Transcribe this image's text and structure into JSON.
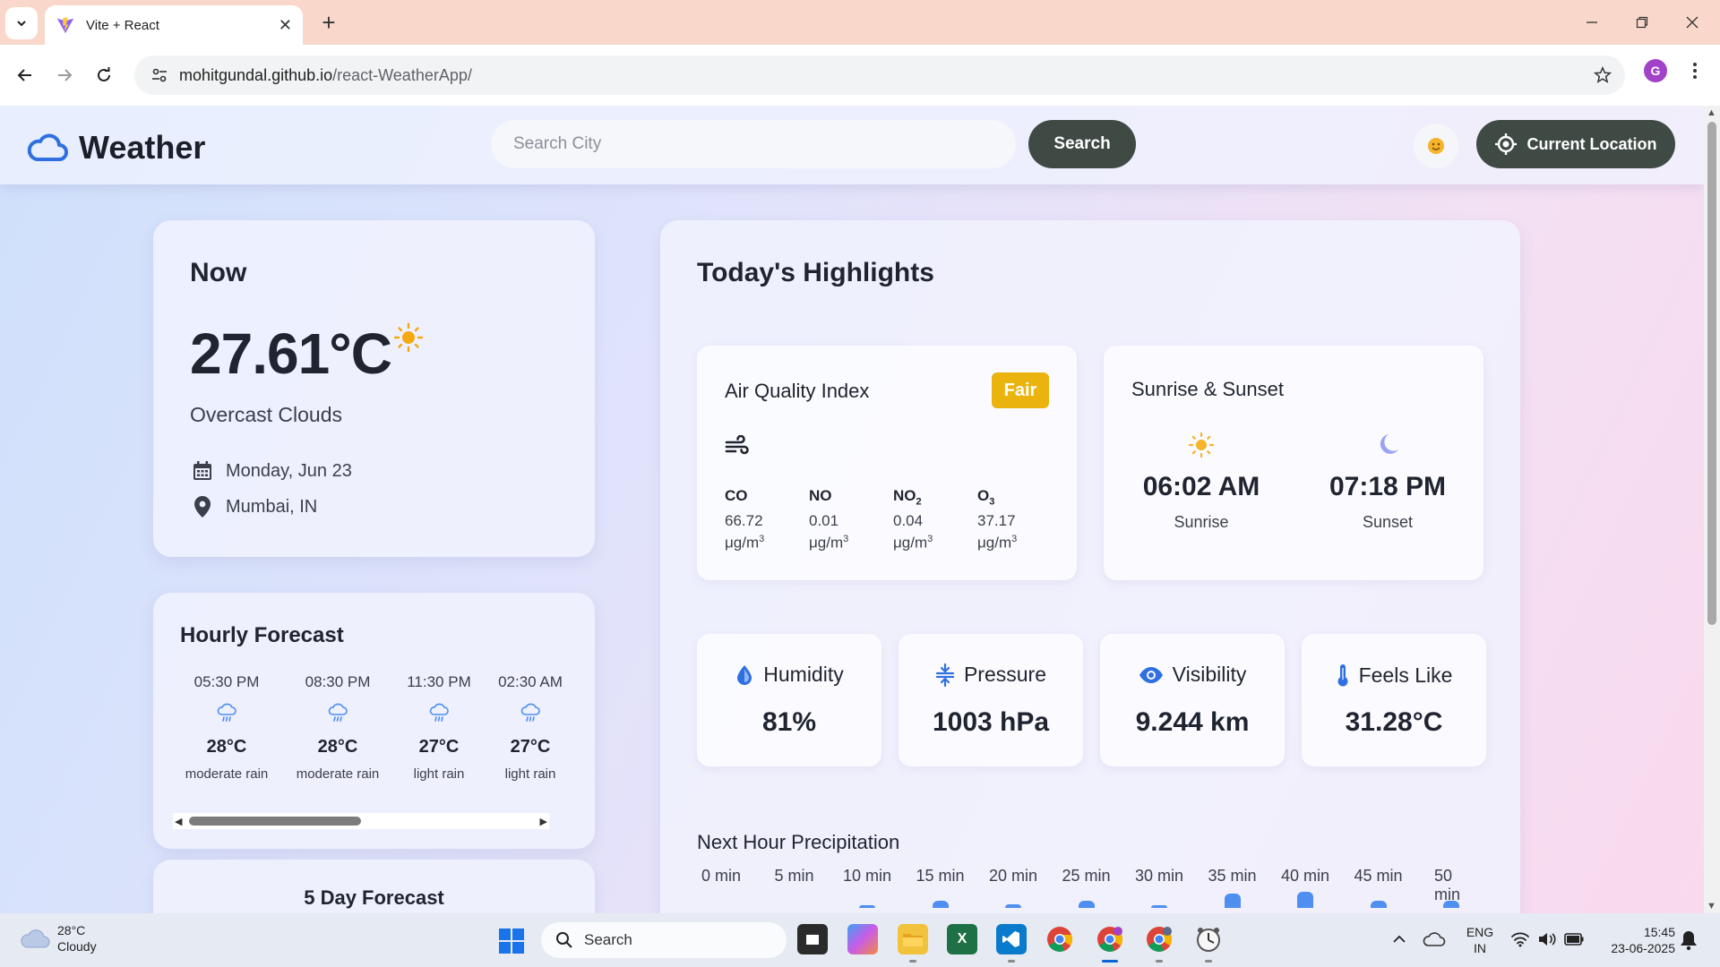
{
  "browser": {
    "tab_title": "Vite + React",
    "url_host": "mohitgundal.github.io",
    "url_path": "/react-WeatherApp/",
    "profile_initial": "G"
  },
  "header": {
    "brand": "Weather",
    "search_placeholder": "Search City",
    "search_button": "Search",
    "location_button": "Current Location"
  },
  "now": {
    "label": "Now",
    "temperature": "27.61°C",
    "description": "Overcast Clouds",
    "date": "Monday, Jun 23",
    "location": "Mumbai, IN"
  },
  "hourly": {
    "title": "Hourly Forecast",
    "items": [
      {
        "time": "05:30 PM",
        "temp": "28°C",
        "desc": "moderate rain",
        "icon": "rain-icon"
      },
      {
        "time": "08:30 PM",
        "temp": "28°C",
        "desc": "moderate rain",
        "icon": "rain-icon"
      },
      {
        "time": "11:30 PM",
        "temp": "27°C",
        "desc": "light rain",
        "icon": "rain-icon"
      },
      {
        "time": "02:30 AM",
        "temp": "27°C",
        "desc": "light rain",
        "icon": "rain-icon"
      }
    ]
  },
  "five_day": {
    "title": "5 Day Forecast"
  },
  "highlights": {
    "title": "Today's Highlights",
    "aqi": {
      "title": "Air Quality Index",
      "badge": "Fair",
      "badge_color": "#ebb30d",
      "unit": "μg/m",
      "unit_exp": "3",
      "pollutants": [
        {
          "name": "CO",
          "sub": "",
          "value": "66.72"
        },
        {
          "name": "NO",
          "sub": "",
          "value": "0.01"
        },
        {
          "name": "NO",
          "sub": "2",
          "value": "0.04"
        },
        {
          "name": "O",
          "sub": "3",
          "value": "37.17"
        }
      ]
    },
    "sun": {
      "title": "Sunrise & Sunset",
      "sunrise_time": "06:02 AM",
      "sunrise_label": "Sunrise",
      "sunset_time": "07:18 PM",
      "sunset_label": "Sunset"
    },
    "metrics": [
      {
        "label": "Humidity",
        "value": "81%",
        "icon": "droplet-icon"
      },
      {
        "label": "Pressure",
        "value": "1003 hPa",
        "icon": "pressure-icon"
      },
      {
        "label": "Visibility",
        "value": "9.244 km",
        "icon": "eye-icon"
      },
      {
        "label": "Feels Like",
        "value": "31.28°C",
        "icon": "thermometer-icon"
      }
    ],
    "precipitation": {
      "title": "Next Hour Precipitation",
      "labels": [
        "0 min",
        "5 min",
        "10 min",
        "15 min",
        "20 min",
        "25 min",
        "30 min",
        "35 min",
        "40 min",
        "45 min",
        "50 min"
      ],
      "values": [
        0,
        0,
        0.5,
        2,
        1,
        2,
        0.5,
        4,
        4.5,
        2,
        2
      ]
    }
  },
  "taskbar": {
    "weather_temp": "28°C",
    "weather_desc": "Cloudy",
    "search_label": "Search",
    "lang_1": "ENG",
    "lang_2": "IN",
    "time": "15:45",
    "date": "23-06-2025"
  },
  "colors": {
    "accent_dark": "#3f4a45",
    "aqi_fair": "#ebb30d",
    "icon_blue": "#2f6fe0",
    "sun": "#f5a90f"
  }
}
